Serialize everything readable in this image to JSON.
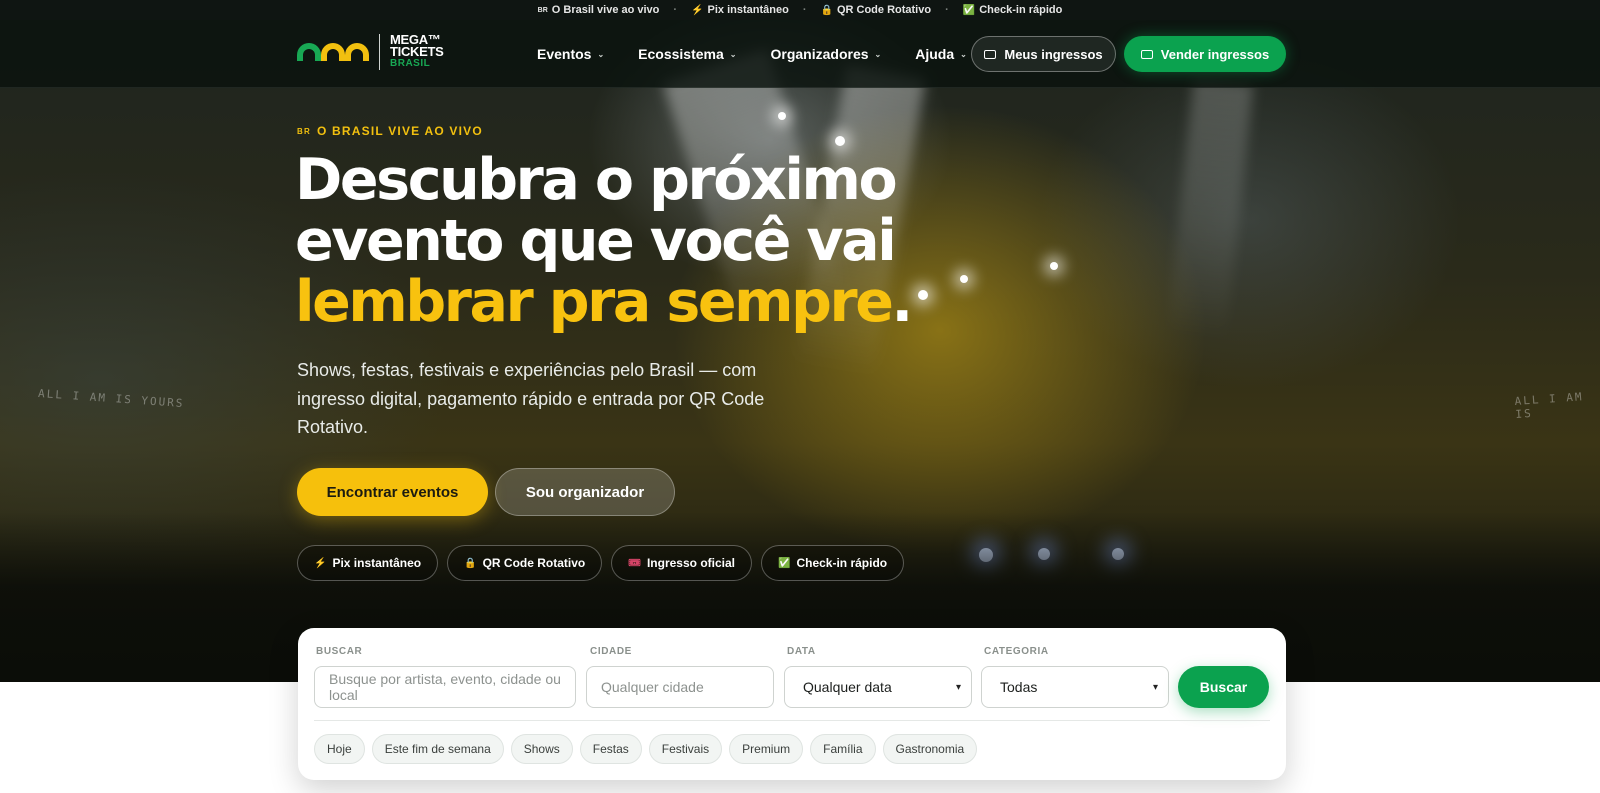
{
  "topbar": {
    "items": [
      {
        "icon": "br-flag-icon",
        "label": "O Brasil vive ao vivo",
        "glyph": "BR"
      },
      {
        "icon": "lightning-icon",
        "label": "Pix instantâneo",
        "glyph": "⚡"
      },
      {
        "icon": "lock-icon",
        "label": "QR Code Rotativo",
        "glyph": "🔒"
      },
      {
        "icon": "check-icon",
        "label": "Check-in rápido",
        "glyph": "✅"
      }
    ],
    "separator": "·"
  },
  "brand": {
    "line1": "MEGA™",
    "line2": "TICKETS",
    "line3": "BRASIL",
    "arch_colors": [
      "#18a854",
      "#f2c00f",
      "#f2c00f"
    ]
  },
  "nav": {
    "items": [
      {
        "label": "Eventos"
      },
      {
        "label": "Ecossistema"
      },
      {
        "label": "Organizadores"
      },
      {
        "label": "Ajuda"
      }
    ],
    "my_tickets": "Meus ingressos",
    "sell_tickets": "Vender ingressos"
  },
  "hero": {
    "eyebrow_flag": "BR",
    "eyebrow": "O BRASIL VIVE AO VIVO",
    "headline_line1": "Descubra o próximo",
    "headline_line2": "evento que você vai",
    "headline_highlight": "lembrar pra sempre",
    "headline_end": ".",
    "subtext": "Shows, festas, festivais e experiências pelo Brasil — com ingresso digital, pagamento rápido e entrada por QR Code Rotativo.",
    "cta_primary": "Encontrar eventos",
    "cta_secondary": "Sou organizador",
    "chips": [
      {
        "glyph": "⚡",
        "icon": "lightning-icon",
        "label": "Pix instantâneo"
      },
      {
        "glyph": "🔒",
        "icon": "lock-icon",
        "label": "QR Code Rotativo"
      },
      {
        "glyph": "🎟",
        "icon": "ticket-icon",
        "label": "Ingresso oficial"
      },
      {
        "glyph": "✅",
        "icon": "check-icon",
        "label": "Check-in rápido"
      }
    ],
    "stage_text": "ALL I AM IS YOURS",
    "stage_text_right": "ALL I AM IS"
  },
  "search": {
    "label_buscar": "BUSCAR",
    "placeholder_buscar": "Busque por artista, evento, cidade ou local",
    "label_cidade": "CIDADE",
    "placeholder_cidade": "Qualquer cidade",
    "label_data": "DATA",
    "data_value": "Qualquer data",
    "label_categoria": "CATEGORIA",
    "categoria_value": "Todas",
    "button": "Buscar",
    "tags": [
      "Hoje",
      "Este fim de semana",
      "Shows",
      "Festas",
      "Festivais",
      "Premium",
      "Família",
      "Gastronomia"
    ]
  },
  "colors": {
    "accent_yellow": "#f6c00c",
    "accent_green": "#0ba24f"
  }
}
